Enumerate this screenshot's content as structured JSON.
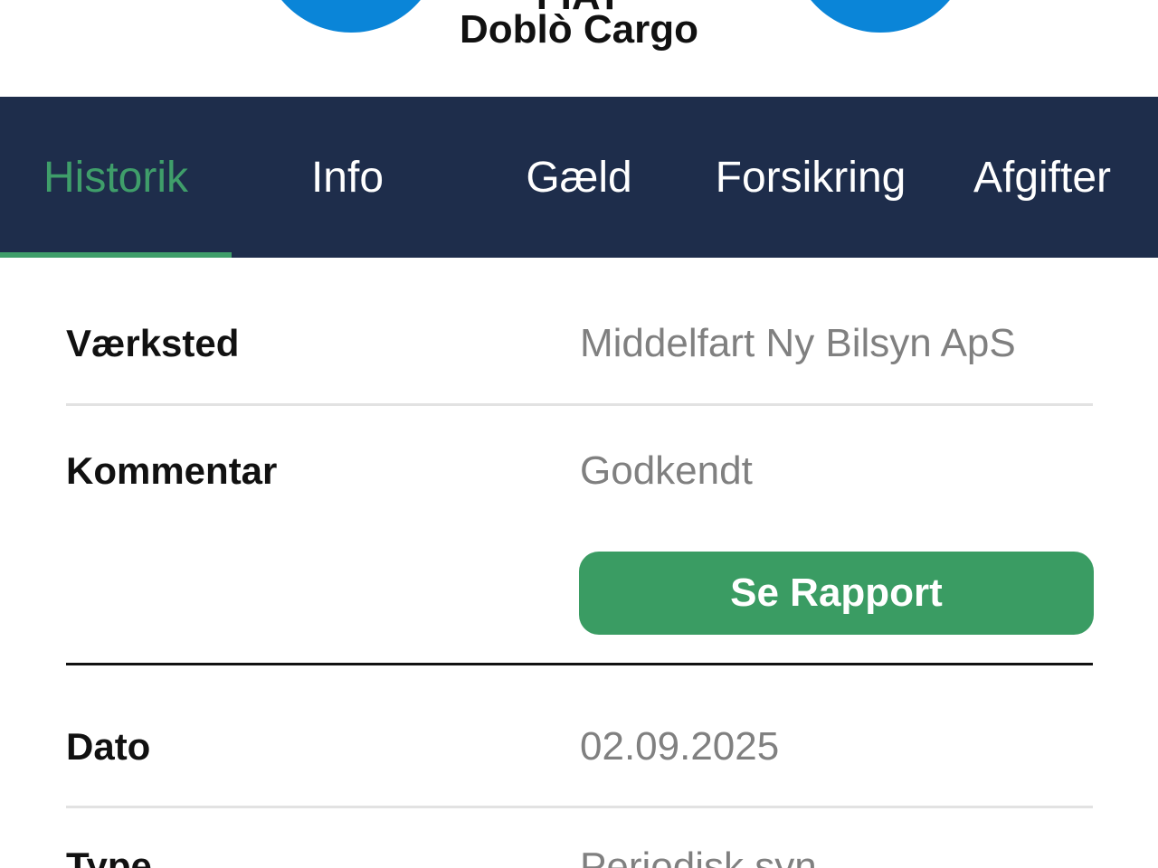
{
  "vehicle": {
    "make": "FIAT",
    "model": "Doblò Cargo"
  },
  "colors": {
    "header_circle": "#0a85d8",
    "tabbar_bg": "#1e2d4b",
    "accent_green": "#3f9e6a",
    "button_green": "#3a9c63"
  },
  "tabs": [
    {
      "label": "Historik",
      "active": true
    },
    {
      "label": "Info",
      "active": false
    },
    {
      "label": "Gæld",
      "active": false
    },
    {
      "label": "Forsikring",
      "active": false
    },
    {
      "label": "Afgifter",
      "active": false
    }
  ],
  "records": [
    {
      "workshop_label": "Værksted",
      "workshop_value": "Middelfart Ny Bilsyn ApS",
      "comment_label": "Kommentar",
      "comment_value": "Godkendt",
      "report_button": "Se Rapport"
    },
    {
      "date_label": "Dato",
      "date_value": "02.09.2025",
      "type_label": "Type",
      "type_value": "Periodisk syn"
    }
  ]
}
